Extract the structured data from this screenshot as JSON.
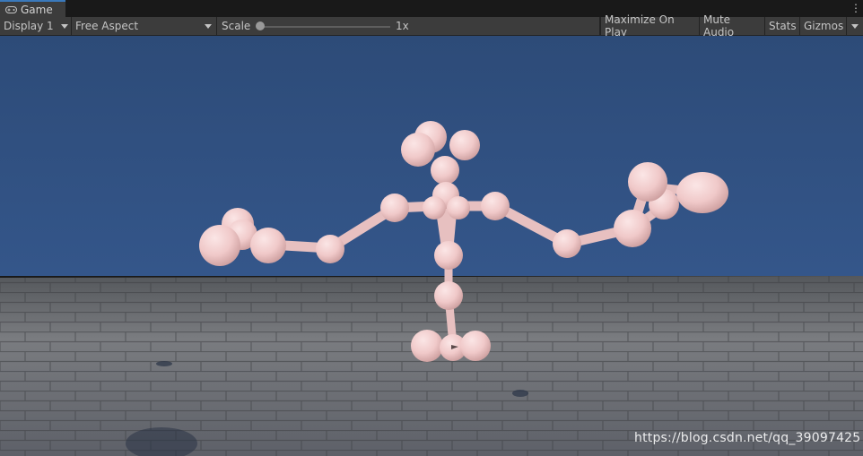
{
  "window": {
    "tab_title": "Game",
    "tab_icon": "gamepad-icon",
    "menu_icon": "vertical-ellipsis-icon"
  },
  "toolbar": {
    "display_label": "Display 1",
    "aspect_label": "Free Aspect",
    "scale_label": "Scale",
    "scale_value": "1x",
    "scale_fraction": 0.0,
    "maximize_label": "Maximize On Play",
    "mute_label": "Mute Audio",
    "stats_label": "Stats",
    "gizmos_label": "Gizmos"
  },
  "scene": {
    "sky_color": "#2f4f7f",
    "model_color": "#f2cfcf",
    "floor_color": "#6e7074",
    "watermark": "https://blog.csdn.net/qq_39097425"
  }
}
